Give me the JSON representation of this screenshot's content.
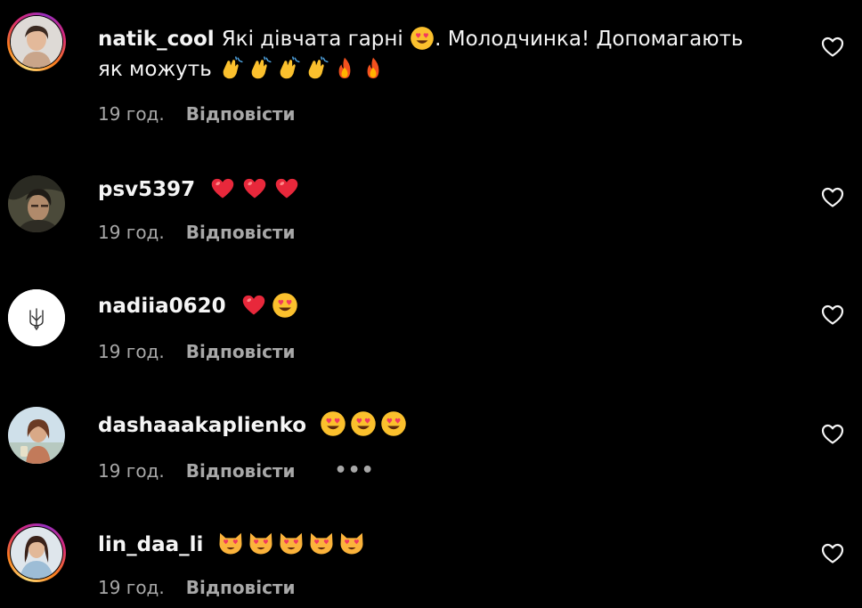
{
  "comments": [
    {
      "username": "natik_cool",
      "text_part1": "Які дівчата гарні",
      "text_part2": ". Молодчинка! Допомагають",
      "text_line2": "як можуть",
      "time": "19 год.",
      "reply_label": "Відповісти"
    },
    {
      "username": "psv5397",
      "time": "19 год.",
      "reply_label": "Відповісти"
    },
    {
      "username": "nadiia0620",
      "time": "19 год.",
      "reply_label": "Відповісти"
    },
    {
      "username": "dashaaakaplienko",
      "time": "19 год.",
      "reply_label": "Відповісти",
      "more_label": "•••"
    },
    {
      "username": "lin_daa_li",
      "time": "19 год.",
      "reply_label": "Відповісти"
    }
  ],
  "icons": {
    "like": "heart-outline-icon",
    "emojis": [
      "heart-eyes-face",
      "clapping-hands",
      "fire",
      "red-heart",
      "heart-eyes-cat"
    ]
  },
  "colors": {
    "background": "#000000",
    "text": "#f5f5f5",
    "meta": "#a8a8a8",
    "heart": "#e8283b",
    "emoji_yellow": "#fbc02d"
  }
}
